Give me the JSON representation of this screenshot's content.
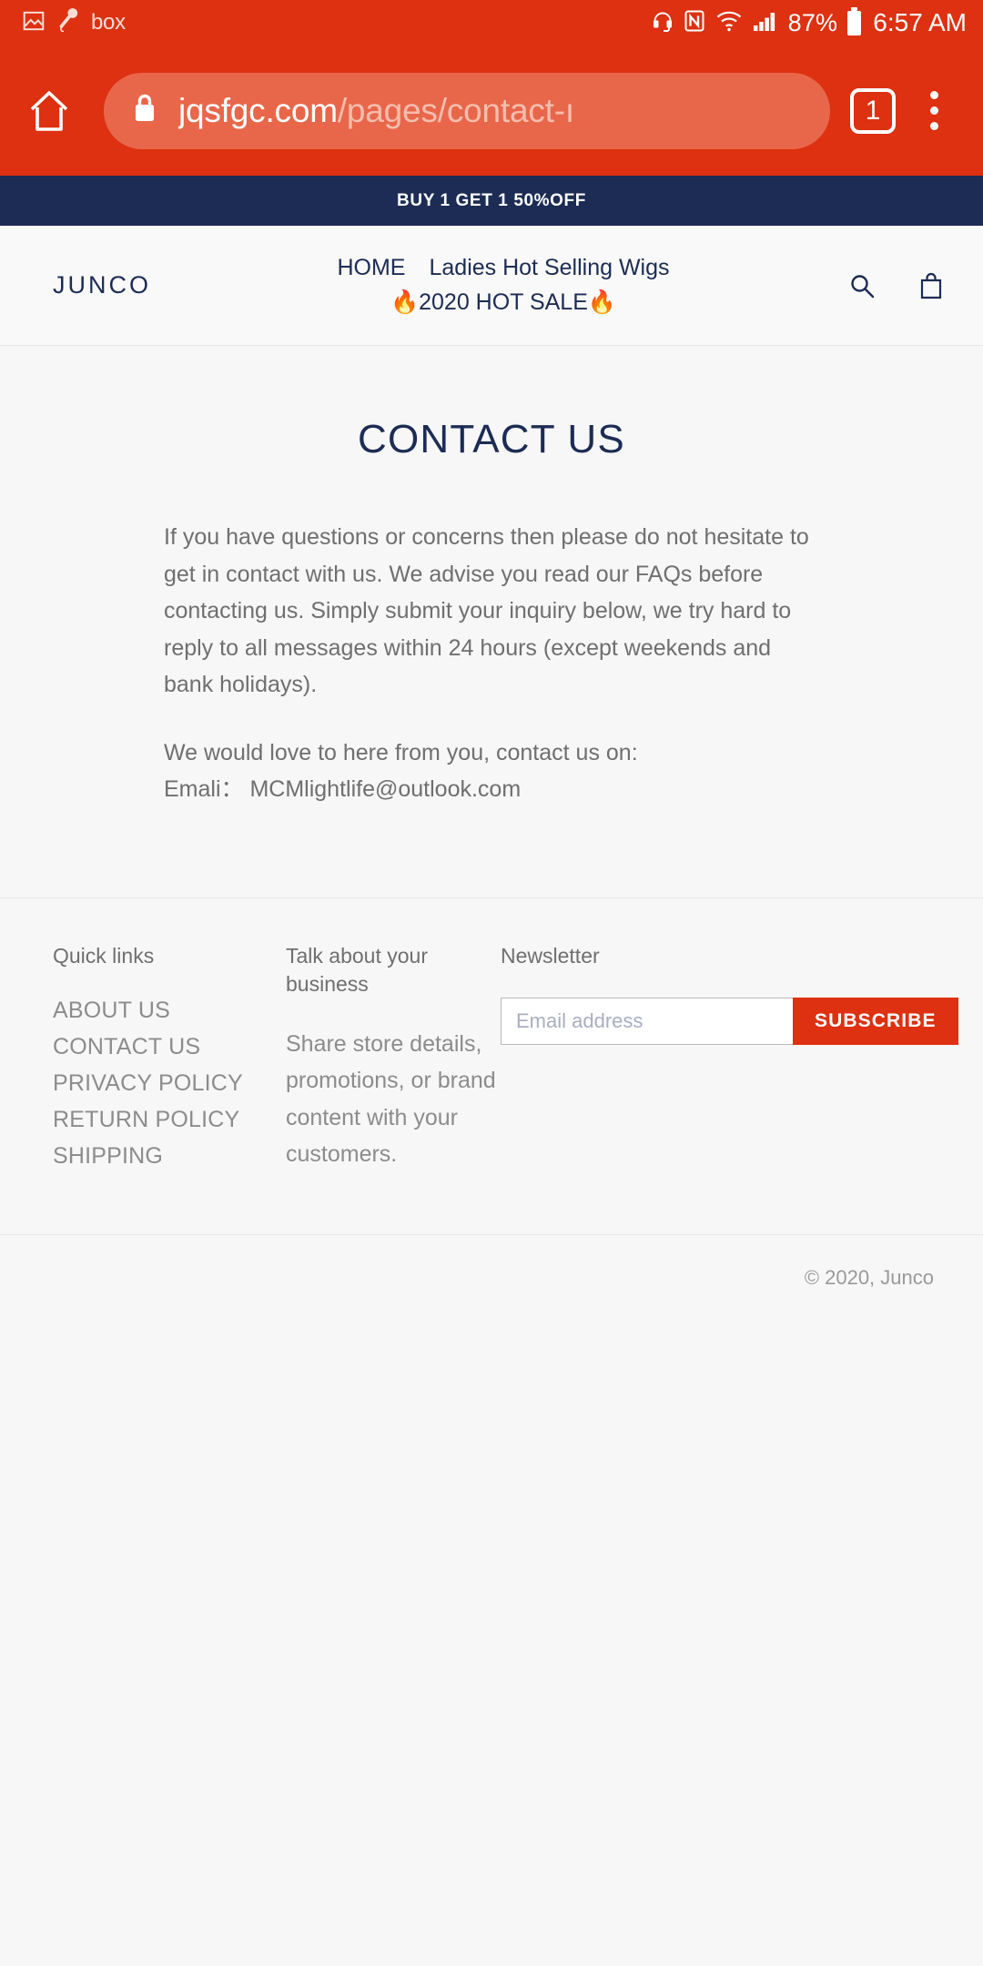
{
  "status_bar": {
    "icons": [
      "image-icon",
      "microphone-icon"
    ],
    "box_label": "box",
    "right_icons": [
      "headset-icon",
      "nfc-icon",
      "wifi-icon",
      "signal-icon"
    ],
    "battery_percent": "87%",
    "time": "6:57 AM"
  },
  "browser": {
    "home_icon": "home-icon",
    "lock_icon": "lock-icon",
    "url_domain": "jqsfgc.com",
    "url_path": "/pages/contact-ı",
    "tab_count": "1",
    "menu_icon": "overflow-menu-icon",
    "chrome_color": "#dd3112",
    "omnibox_color": "#e8674a"
  },
  "announcement": {
    "text": "BUY 1 GET 1 50%OFF",
    "background": "#1c2c54"
  },
  "header": {
    "logo": "JUNCO",
    "nav": [
      {
        "label": "HOME"
      },
      {
        "label": "Ladies Hot Selling Wigs"
      },
      {
        "label": "🔥2020 HOT SALE🔥"
      }
    ],
    "search_icon": "search-icon",
    "cart_icon": "shopping-bag-icon",
    "accent_color": "#1c2c54"
  },
  "main": {
    "title": "CONTACT US",
    "paragraphs": [
      "If you have questions or concerns then please do not hesitate to get in contact with us. We advise you read our FAQs before contacting us. Simply submit your inquiry below, we try hard to reply to all messages within 24 hours (except weekends and bank holidays).",
      "We would love to here from you, contact us on:\nEmali： MCMlightlife@outlook.com"
    ]
  },
  "footer": {
    "quick_links": {
      "heading": "Quick links",
      "items": [
        {
          "label": "ABOUT US"
        },
        {
          "label": "CONTACT US"
        },
        {
          "label": "PRIVACY POLICY"
        },
        {
          "label": "RETURN POLICY"
        },
        {
          "label": "SHIPPING"
        }
      ]
    },
    "about": {
      "heading": "Talk about your business",
      "body": "Share store details, promotions, or brand content with your customers."
    },
    "newsletter": {
      "heading": "Newsletter",
      "placeholder": "Email address",
      "value": "",
      "subscribe_label": "SUBSCRIBE",
      "button_color": "#dd3112"
    },
    "copyright": "© 2020, Junco"
  }
}
